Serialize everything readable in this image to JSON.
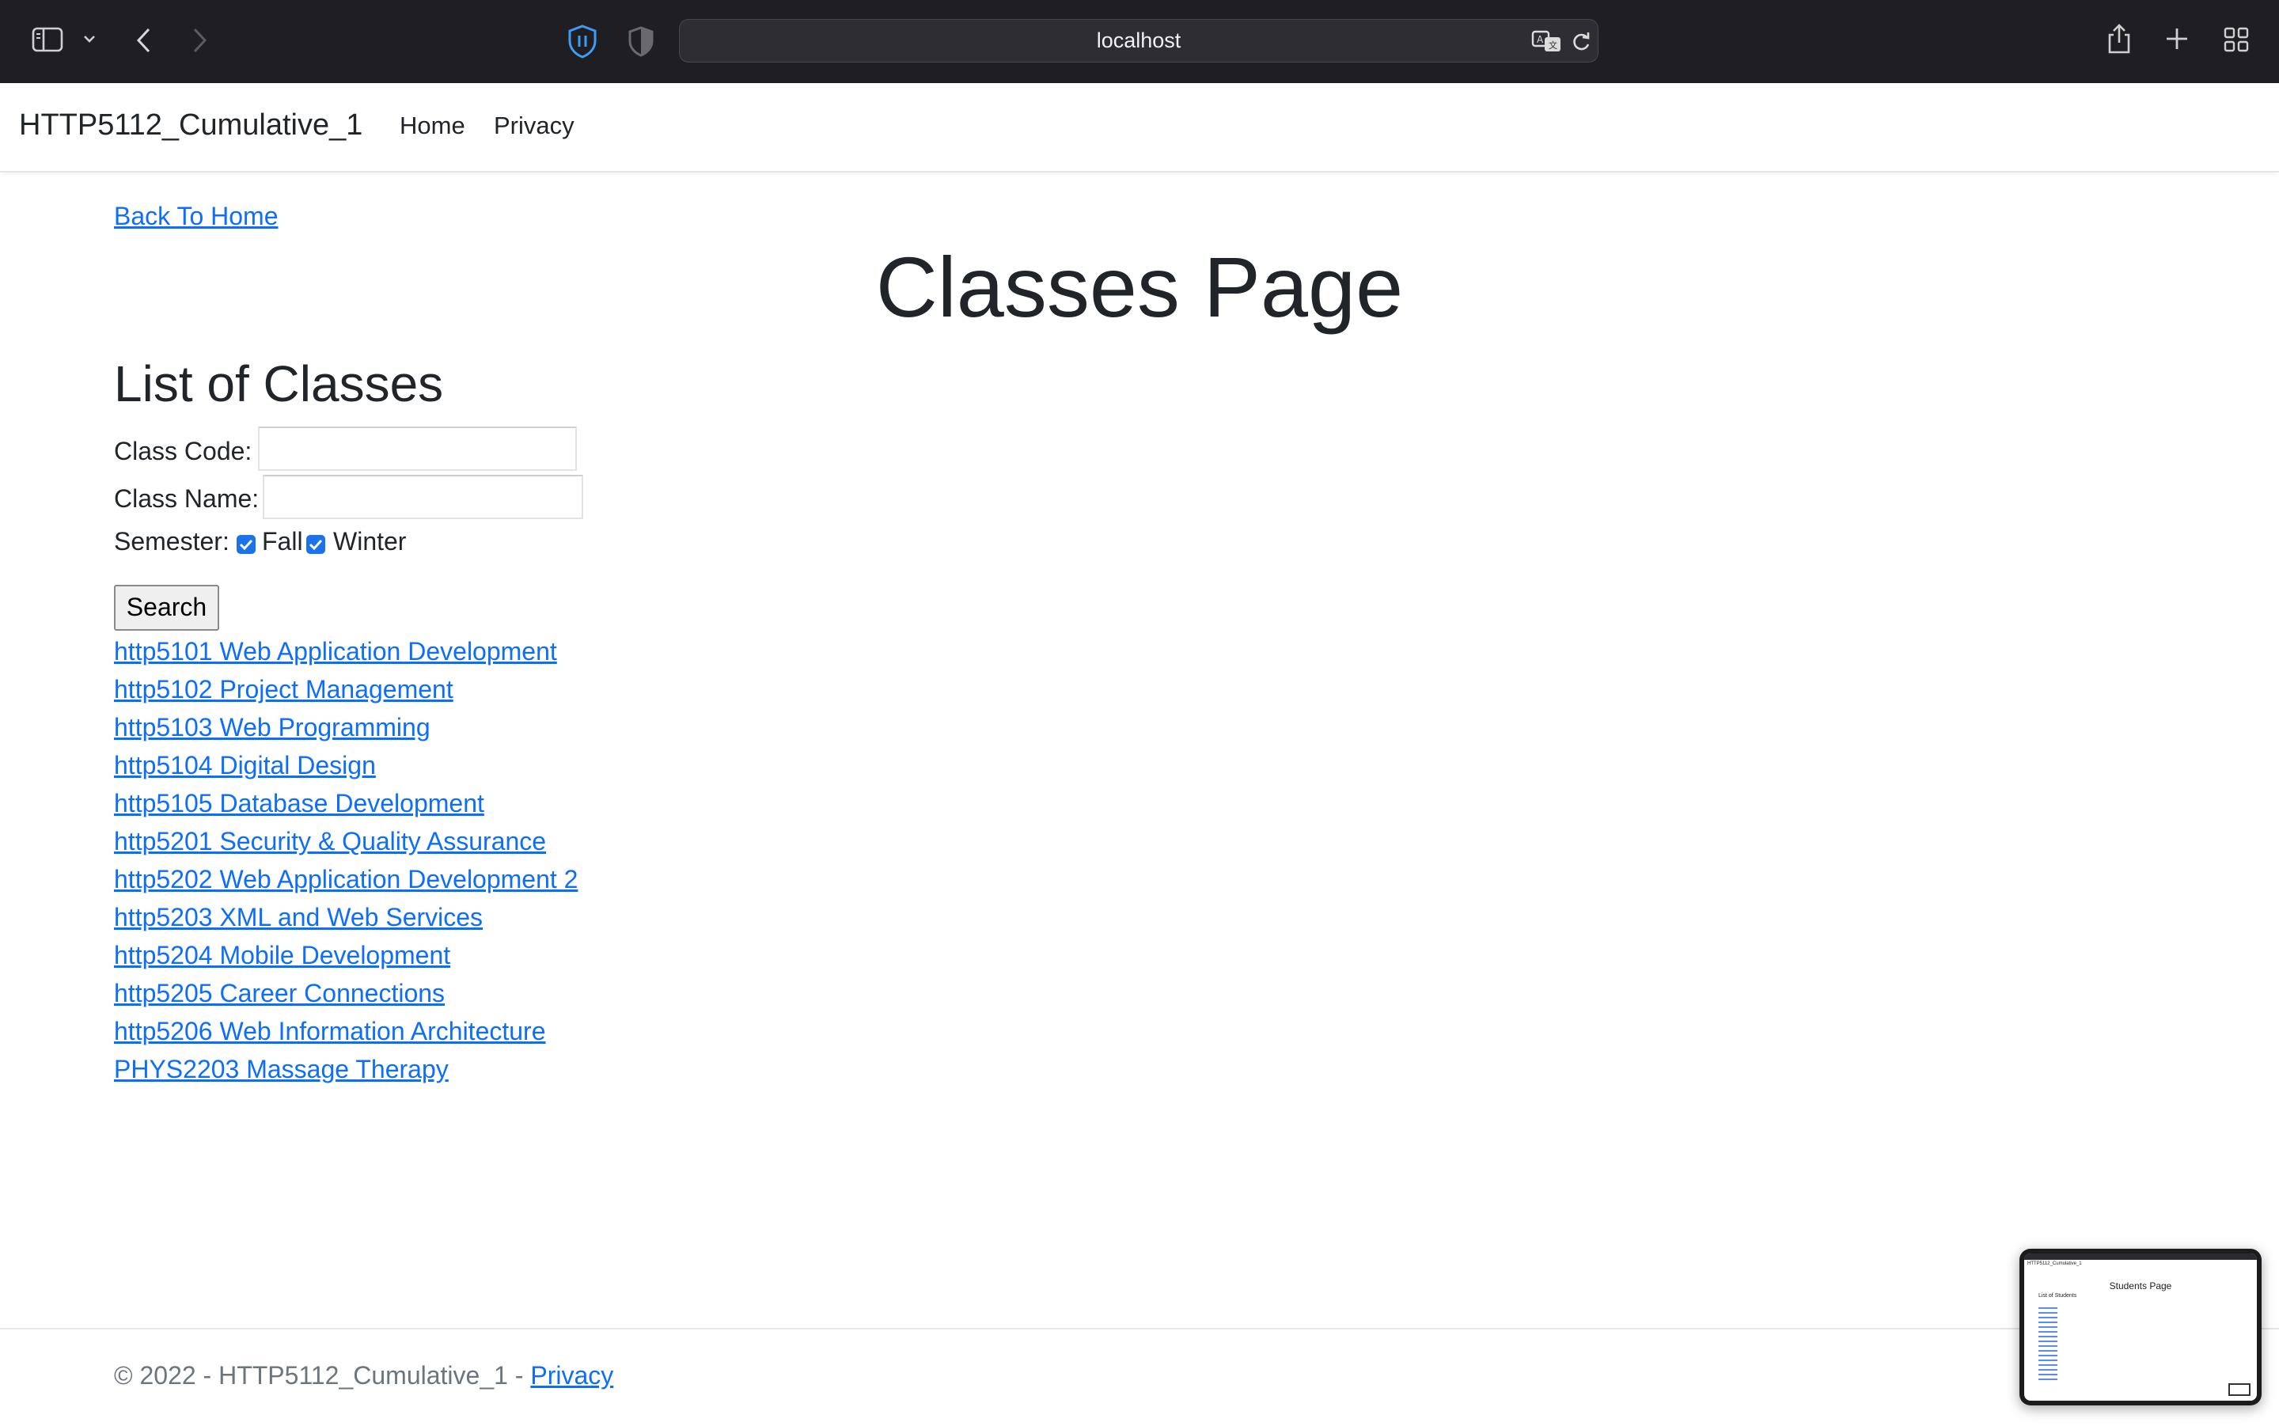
{
  "browser": {
    "url": "localhost",
    "icons": {
      "sidebar": "sidebar-icon",
      "tab_overview_menu": "chevron-down-icon",
      "back": "chevron-left-icon",
      "forward": "chevron-right-icon",
      "privacy_report": "shield-icon",
      "extension": "half-shield-icon",
      "translate": "translate-icon",
      "reload": "reload-icon",
      "share": "share-icon",
      "new_tab": "plus-icon",
      "tab_overview": "grid-icon"
    }
  },
  "navbar": {
    "brand": "HTTP5112_Cumulative_1",
    "links": [
      "Home",
      "Privacy"
    ]
  },
  "main": {
    "back_link": "Back To Home",
    "page_title": "Classes Page",
    "section_title": "List of Classes",
    "form": {
      "class_code_label": "Class Code:",
      "class_code_value": "",
      "class_name_label": "Class Name:",
      "class_name_value": "",
      "semester_label": "Semester:",
      "semesters": [
        {
          "label": "Fall",
          "checked": true
        },
        {
          "label": "Winter",
          "checked": true
        }
      ],
      "search_button": "Search"
    },
    "classes": [
      "http5101 Web Application Development",
      "http5102 Project Management",
      "http5103 Web Programming",
      "http5104 Digital Design",
      "http5105 Database Development",
      "http5201 Security & Quality Assurance",
      "http5202 Web Application Development 2",
      "http5203 XML and Web Services",
      "http5204 Mobile Development",
      "http5205 Career Connections",
      "http5206 Web Information Architecture",
      "PHYS2203 Massage Therapy"
    ]
  },
  "footer": {
    "text": "© 2022 - HTTP5112_Cumulative_1 - ",
    "link": "Privacy"
  },
  "preview": {
    "title": "Students Page",
    "subtitle": "List of Students"
  },
  "colors": {
    "chrome_bg": "#1f1e23",
    "link": "#0d6efd",
    "checkbox": "#1a73e8",
    "text": "#212529",
    "muted": "#6c757d"
  }
}
